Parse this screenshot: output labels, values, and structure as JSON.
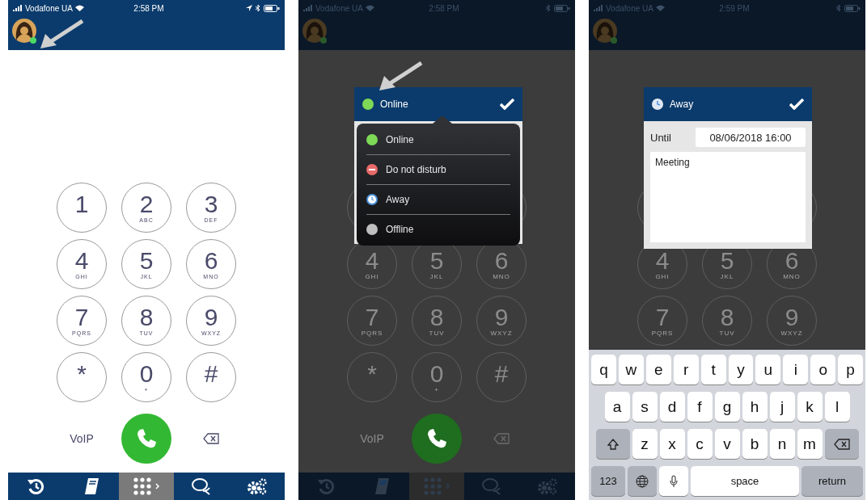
{
  "phones": [
    {
      "dimmed": false,
      "arrow": true,
      "status_bar": {
        "carrier": "Vodafone UA",
        "time": "2:58 PM",
        "location": true
      },
      "keypad": [
        [
          {
            "digit": "1"
          },
          {
            "digit": "2",
            "letters": "ABC"
          },
          {
            "digit": "3",
            "letters": "DEF"
          }
        ],
        [
          {
            "digit": "4",
            "letters": "GHI"
          },
          {
            "digit": "5",
            "letters": "JKL"
          },
          {
            "digit": "6",
            "letters": "MNO"
          }
        ],
        [
          {
            "digit": "7",
            "letters": "PQRS"
          },
          {
            "digit": "8",
            "letters": "TUV"
          },
          {
            "digit": "9",
            "letters": "WXYZ"
          }
        ],
        [
          {
            "digit": "*"
          },
          {
            "digit": "0",
            "letters": "+"
          },
          {
            "digit": "#"
          }
        ]
      ],
      "actions": {
        "left": "VoIP"
      },
      "tab_bar": [
        {
          "kind": "history",
          "selected": false
        },
        {
          "kind": "contacts",
          "selected": false
        },
        {
          "kind": "keypad",
          "selected": true
        },
        {
          "kind": "chat",
          "selected": false
        },
        {
          "kind": "settings",
          "selected": false
        }
      ]
    },
    {
      "dimmed": true,
      "arrow": true,
      "status_bar": {
        "carrier": "Vodafone UA",
        "time": "2:58 PM",
        "location": false
      },
      "keypad": [
        [
          {
            "digit": "4",
            "letters": "GHI"
          },
          {
            "digit": "5",
            "letters": "JKL"
          },
          {
            "digit": "6",
            "letters": "MNO"
          }
        ],
        [
          {
            "digit": "7",
            "letters": "PQRS"
          },
          {
            "digit": "8",
            "letters": "TUV"
          },
          {
            "digit": "9",
            "letters": "WXYZ"
          }
        ],
        [
          {
            "digit": "*"
          },
          {
            "digit": "0",
            "letters": "+"
          },
          {
            "digit": "#"
          }
        ]
      ],
      "actions": {
        "left": "VoIP"
      },
      "tab_bar": [
        {
          "kind": "history",
          "selected": false
        },
        {
          "kind": "contacts",
          "selected": false
        },
        {
          "kind": "keypad",
          "selected": true
        },
        {
          "kind": "chat",
          "selected": false
        },
        {
          "kind": "settings",
          "selected": false
        }
      ],
      "popup": {
        "kind": "status_menu",
        "title": "Online",
        "color": "#7ed957",
        "items": [
          {
            "kind": "dot",
            "label": "Online",
            "color": "#7ed957"
          },
          {
            "kind": "minus",
            "label": "Do not disturb",
            "color": "#e86a6a"
          },
          {
            "kind": "clock",
            "label": "Away",
            "color": "#4a90d9"
          },
          {
            "kind": "dot",
            "label": "Offline",
            "color": "#bfbfbf"
          }
        ]
      }
    },
    {
      "dimmed": true,
      "arrow": false,
      "status_bar": {
        "carrier": "Vodafone UA",
        "time": "2:59 PM",
        "location": false
      },
      "keypad": [
        [
          {
            "digit": "4",
            "letters": "GHI"
          },
          {
            "digit": "5",
            "letters": "JKL"
          },
          {
            "digit": "6",
            "letters": "MNO"
          }
        ],
        [
          {
            "digit": "7",
            "letters": "PQRS"
          },
          {
            "digit": "8",
            "letters": "TUV"
          },
          {
            "digit": "9",
            "letters": "WXYZ"
          }
        ]
      ],
      "popup": {
        "kind": "away_form",
        "title": "Away",
        "until_label": "Until",
        "until_value": "08/06/2018 16:00",
        "message": "Meeting"
      },
      "keyboard": [
        [
          {
            "kind": "char",
            "label": "q"
          },
          {
            "kind": "char",
            "label": "w"
          },
          {
            "kind": "char",
            "label": "e"
          },
          {
            "kind": "char",
            "label": "r"
          },
          {
            "kind": "char",
            "label": "t"
          },
          {
            "kind": "char",
            "label": "y"
          },
          {
            "kind": "char",
            "label": "u"
          },
          {
            "kind": "char",
            "label": "i"
          },
          {
            "kind": "char",
            "label": "o"
          },
          {
            "kind": "char",
            "label": "p"
          }
        ],
        [
          {
            "kind": "char",
            "label": "a"
          },
          {
            "kind": "char",
            "label": "s"
          },
          {
            "kind": "char",
            "label": "d"
          },
          {
            "kind": "char",
            "label": "f"
          },
          {
            "kind": "char",
            "label": "g"
          },
          {
            "kind": "char",
            "label": "h"
          },
          {
            "kind": "char",
            "label": "j"
          },
          {
            "kind": "char",
            "label": "k"
          },
          {
            "kind": "char",
            "label": "l"
          }
        ],
        [
          {
            "kind": "shift"
          },
          {
            "kind": "char",
            "label": "z"
          },
          {
            "kind": "char",
            "label": "x"
          },
          {
            "kind": "char",
            "label": "c"
          },
          {
            "kind": "char",
            "label": "v"
          },
          {
            "kind": "char",
            "label": "b"
          },
          {
            "kind": "char",
            "label": "n"
          },
          {
            "kind": "char",
            "label": "m"
          },
          {
            "kind": "backspace"
          }
        ],
        [
          {
            "kind": "function",
            "label": "123"
          },
          {
            "kind": "globe"
          },
          {
            "kind": "mic"
          },
          {
            "kind": "space",
            "label": "space"
          },
          {
            "kind": "return",
            "label": "return"
          }
        ]
      ]
    }
  ]
}
